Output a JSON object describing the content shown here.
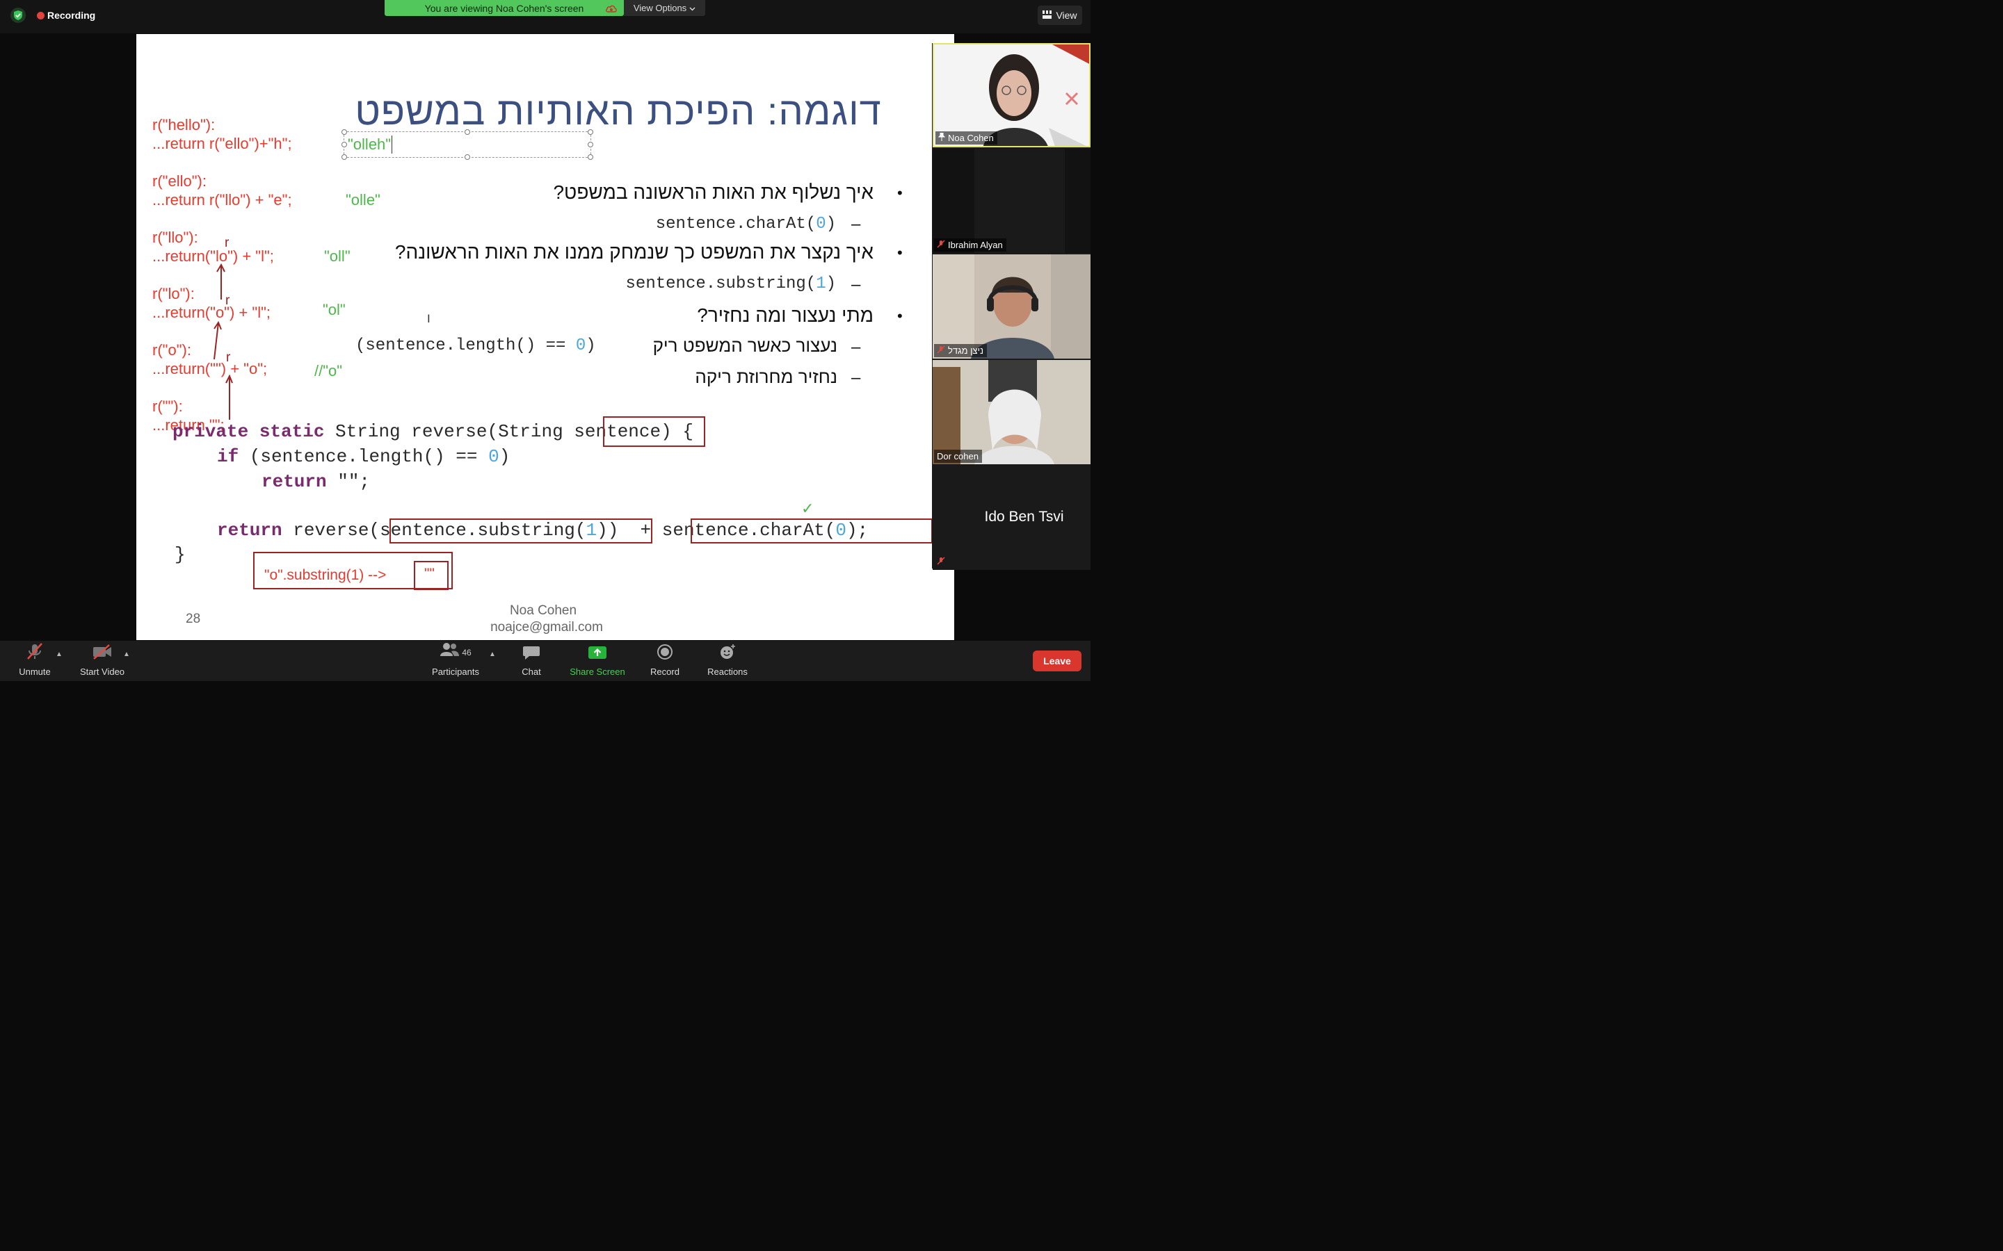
{
  "topbar": {
    "recording_label": "Recording",
    "viewing_banner": "You are viewing Noa Cohen's screen",
    "view_options_label": "View Options",
    "view_button_label": "View"
  },
  "slide": {
    "title": "דוגמה: הפיכת האותיות במשפט",
    "trace": [
      {
        "call": "r(\"hello\"):",
        "ret": "...return r(\"ello\")+\"h\";",
        "result": "\"olleh\""
      },
      {
        "call": "r(\"ello\"):",
        "ret": "...return r(\"llo\") + \"e\";",
        "result": "\"olle\""
      },
      {
        "call": "r(\"llo\"):",
        "ret": "...return(\"lo\") + \"l\";",
        "result": "\"oll\""
      },
      {
        "call": "r(\"lo\"):",
        "ret": "...return(\"o\") + \"l\";",
        "result": "\"ol\""
      },
      {
        "call": "r(\"o\"):",
        "ret": "...return(\"\") + \"o\";",
        "result": "//\"o\""
      },
      {
        "call": "r(\"\"):",
        "ret": "...return \"\";"
      }
    ],
    "r_marks": [
      "r",
      "r",
      "r"
    ],
    "bullets": {
      "q1": "איך נשלוף את האות הראשונה במשפט?",
      "a1": "sentence.charAt(0)",
      "q2": "איך נקצר את המשפט כך שנמחק ממנו את האות הראשונה?",
      "a2": "sentence.substring(1)",
      "q3": "מתי נעצור ומה נחזיר?",
      "a3_text": "נעצור כאשר המשפט ריק",
      "a3_code": "(sentence.length() == 0)",
      "a4": "נחזיר מחרוזת ריקה",
      "bullet_glyph": "•",
      "dash_glyph": "–"
    },
    "code": {
      "line1_kw": "private static",
      "line1_rest": " String reverse(String ",
      "line1_param": "sentence",
      "line1_end": ") {",
      "line2_kw": "if",
      "line2_rest": " (sentence.length() == ",
      "line2_num": "0",
      "line2_end": ")",
      "line3_kw": "return",
      "line3_rest": " \"\";",
      "line4_kw": "return",
      "line4_mid": " reverse(",
      "line4_sub": "sentence.substring(",
      "line4_sub_num": "1",
      "line4_sub_end": ")",
      "line4_plus": ")  + ",
      "line4_char": "sentence.charAt(",
      "line4_char_num": "0",
      "line4_char_end": ");",
      "line5": "}"
    },
    "note_box": "\"o\".substring(1) -->",
    "note_box_result": "\"\"",
    "check_mark": "✓",
    "cursor": "I",
    "page_number": "28",
    "footer_name": "Noa Cohen",
    "footer_email": "noajce@gmail.com"
  },
  "participants_panel": [
    {
      "name": "Noa Cohen",
      "muted": false,
      "pinned": true
    },
    {
      "name": "Ibrahim Alyan",
      "muted": true
    },
    {
      "name": "ניצן מגדל",
      "muted": true
    },
    {
      "name": "Dor cohen",
      "muted": false
    },
    {
      "name": "Ido Ben Tsvi",
      "muted": true
    }
  ],
  "bottombar": {
    "unmute": "Unmute",
    "start_video": "Start Video",
    "participants": "Participants",
    "participants_count": "46",
    "chat": "Chat",
    "share_screen": "Share Screen",
    "record": "Record",
    "reactions": "Reactions",
    "leave": "Leave"
  },
  "colors": {
    "share_green": "#52c75b",
    "leave_red": "#d9362e",
    "title_blue": "#3b4f80",
    "trace_red": "#e63b2e",
    "trace_green": "#4db84a",
    "box_red": "#9c2323"
  }
}
